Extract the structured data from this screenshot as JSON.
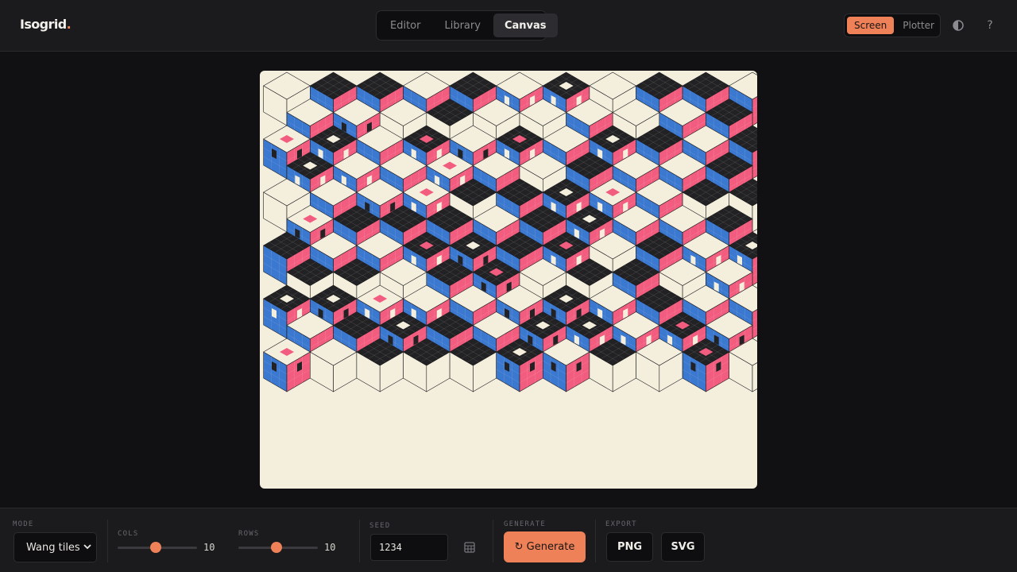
{
  "app": {
    "logo": "Isogrid",
    "logo_dot": "."
  },
  "view_tabs": [
    {
      "label": "Editor",
      "active": false
    },
    {
      "label": "Library",
      "active": false
    },
    {
      "label": "Canvas",
      "active": true
    }
  ],
  "output_mode": {
    "options": [
      {
        "label": "Screen",
        "active": true
      },
      {
        "label": "Plotter",
        "active": false
      }
    ]
  },
  "header_icons": {
    "theme": "contrast-icon",
    "help": "?"
  },
  "canvas": {
    "background": "#f4eedd",
    "palette": {
      "ink": "#222224",
      "blue": "#3b78cf",
      "pink": "#f25d7f",
      "paper": "#f4eedd",
      "accent": "#ee8158"
    }
  },
  "controls": {
    "mode": {
      "label": "MODE",
      "value": "Wang tiles"
    },
    "cols": {
      "label": "COLS",
      "value": 10,
      "min": 1,
      "max": 20
    },
    "rows": {
      "label": "ROWS",
      "value": 10,
      "min": 1,
      "max": 20
    },
    "seed": {
      "label": "SEED",
      "value": "1234"
    },
    "generate": {
      "label": "GENERATE",
      "button": "↻ Generate"
    },
    "export": {
      "label": "EXPORT",
      "png": "PNG",
      "svg": "SVG"
    }
  }
}
